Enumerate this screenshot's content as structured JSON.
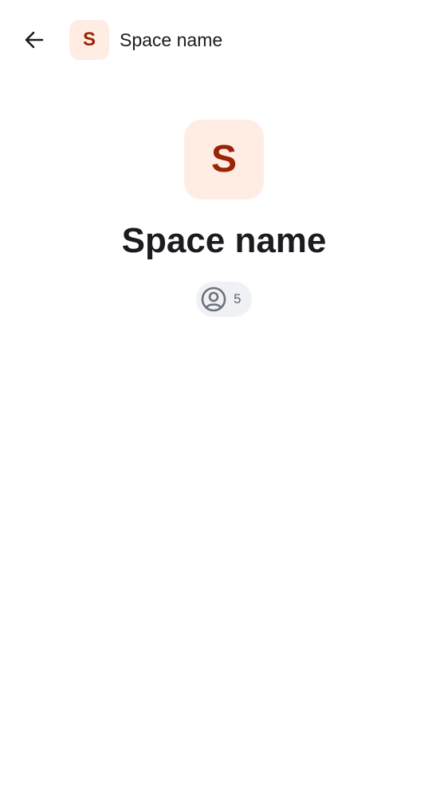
{
  "header": {
    "back_icon": "arrow-left-icon",
    "avatar_letter": "S",
    "title": "Space name"
  },
  "space": {
    "avatar_letter": "S",
    "name": "Space name",
    "member_icon": "user-circle-icon",
    "member_count": "5"
  },
  "colors": {
    "avatar_background": "#ffede3",
    "avatar_letter": "#9a2407",
    "text_primary": "#1b1c1f",
    "chip_background": "#f0f1f4",
    "chip_text": "#5f6670",
    "background": "#ffffff"
  }
}
